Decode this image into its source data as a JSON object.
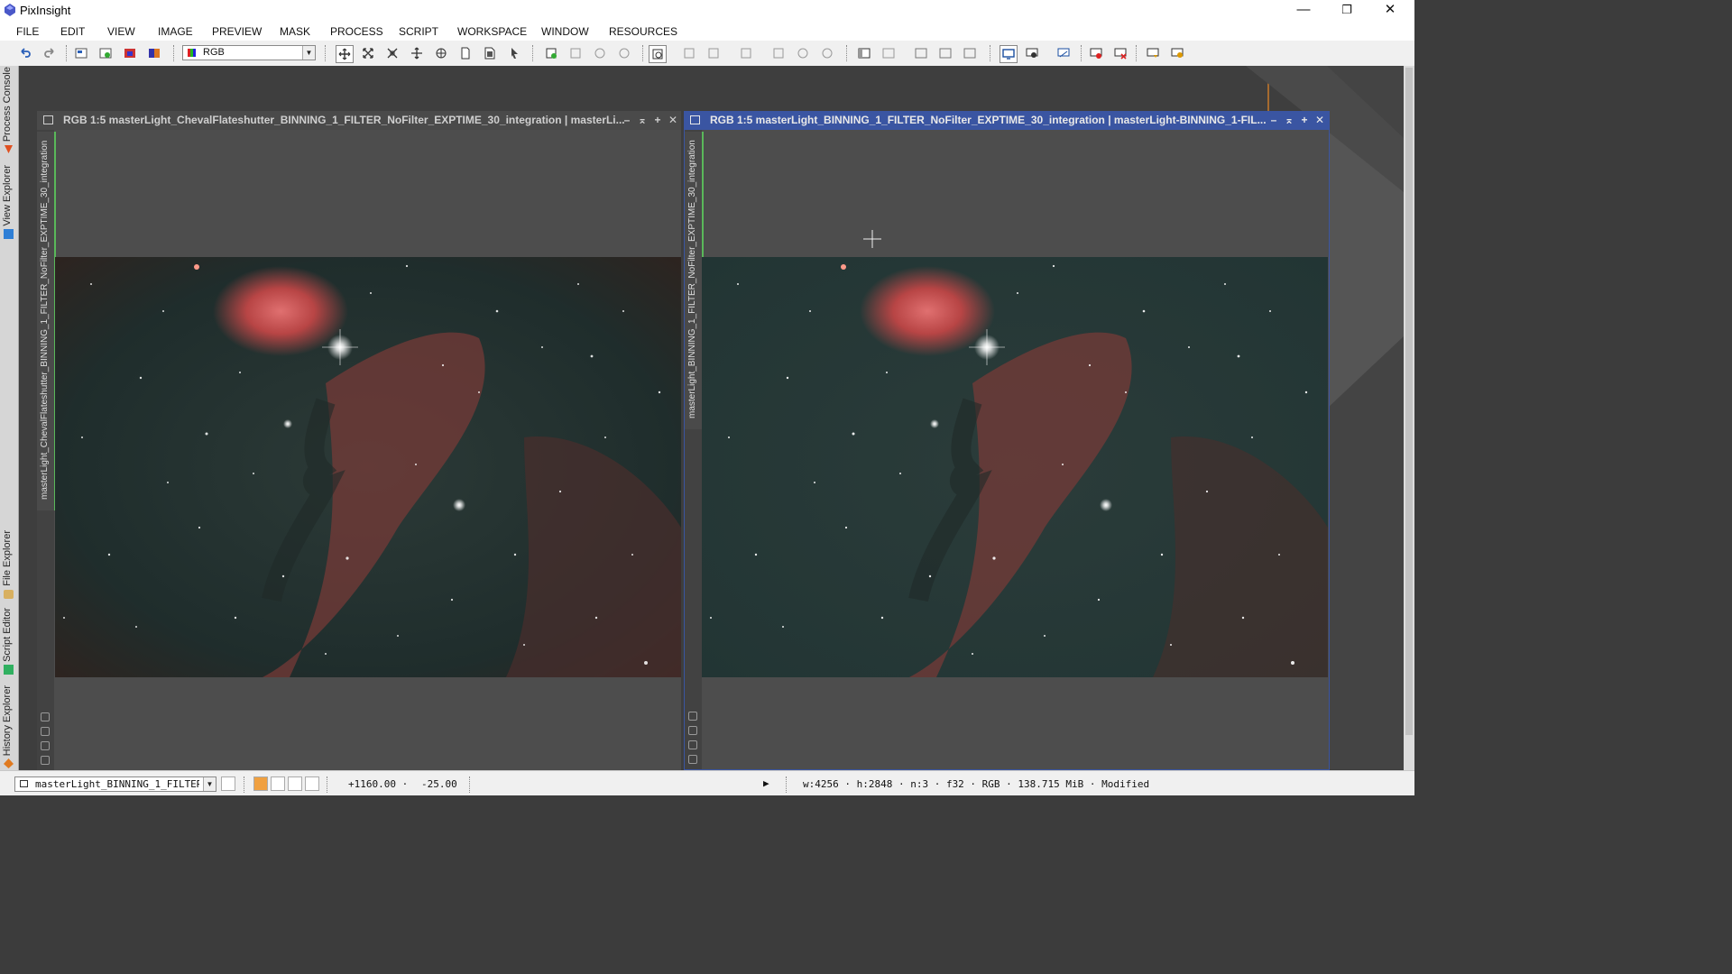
{
  "app": {
    "title": "PixInsight",
    "window_controls": {
      "minimize": "—",
      "restore": "❐",
      "close": "✕"
    }
  },
  "menu": [
    "FILE",
    "EDIT",
    "VIEW",
    "IMAGE",
    "PREVIEW",
    "MASK",
    "PROCESS",
    "SCRIPT",
    "WORKSPACE",
    "WINDOW",
    "RESOURCES"
  ],
  "toolbar": {
    "channel_select": "RGB"
  },
  "left_dock": {
    "tabs": [
      "Process Console",
      "View Explorer",
      "File Explorer",
      "Script Editor",
      "History Explorer"
    ],
    "tab_colors": [
      "#e05020",
      "#2f7fd6",
      "#d8b060",
      "#30b060",
      "#e07a20"
    ]
  },
  "windows": {
    "left": {
      "title": "RGB 1:5 masterLight_ChevalFlateshutter_BINNING_1_FILTER_NoFilter_EXPTIME_30_integration | masterLi...",
      "side_label": "masterLight_ChevalFlateshutter_BINNING_1_FILTER_NoFilter_EXPTIME_30_integration",
      "controls": {
        "minimize": "–",
        "shade": "⌅",
        "maximize": "+",
        "close": "✕"
      }
    },
    "right": {
      "title": "RGB 1:5 masterLight_BINNING_1_FILTER_NoFilter_EXPTIME_30_integration | masterLight-BINNING_1-FIL...",
      "side_label": "masterLight_BINNING_1_FILTER_NoFilter_EXPTIME_30_integration",
      "controls": {
        "minimize": "–",
        "shade": "⌅",
        "maximize": "+",
        "close": "✕"
      }
    }
  },
  "statusbar": {
    "view_select": "masterLight_BINNING_1_FILTER_Nc",
    "x_coord": "+1160.00 ·",
    "y_coord": "-25.00",
    "play": "▶",
    "image_info": "w:4256 · h:2848 · n:3 · f32 · RGB · 138.715 MiB · Modified"
  },
  "accent_colors": {
    "active_title": "#3a55a2",
    "inactive_title": "#4a4a4a",
    "side_tab_border": "#5ab85a"
  }
}
